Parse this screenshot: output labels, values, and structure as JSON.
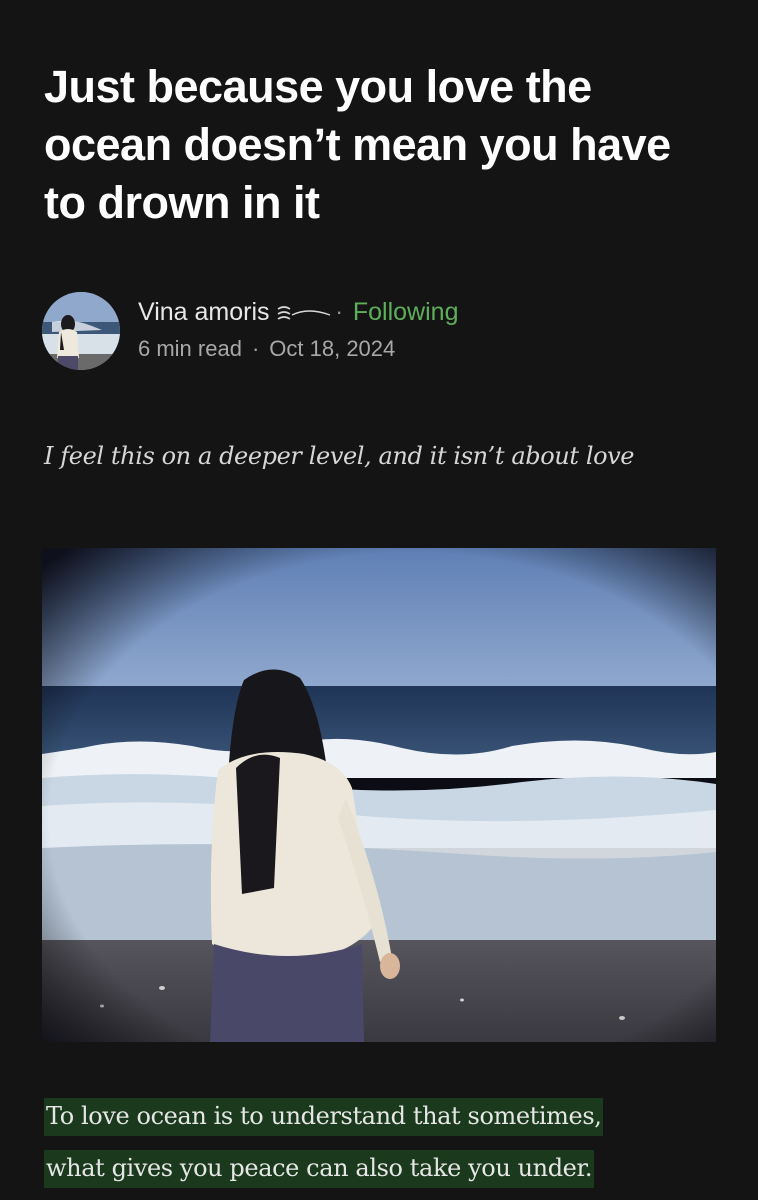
{
  "article": {
    "title": "Just because you love the ocean doesn’t mean you have to drown in it",
    "author": {
      "name": "Vina amoris",
      "follow_status": "Following",
      "separator": "·"
    },
    "read_time": "6 min read",
    "published_date": "Oct 18, 2024",
    "subtitle": "I feel this on a deeper level, and it isn’t about love",
    "hero_image": {
      "subject": "woman-on-beach-facing-ocean"
    },
    "highlighted_paragraph": {
      "line1": "To love ocean is to understand that sometimes,",
      "line2": "what gives you peace can also take you under."
    }
  },
  "colors": {
    "background": "#141414",
    "follow_accent": "#5fae5a",
    "highlight": "#1b3a1d",
    "meta_text": "#a8a8a8"
  },
  "icons": {
    "author_badge": "wave-badge-icon"
  }
}
